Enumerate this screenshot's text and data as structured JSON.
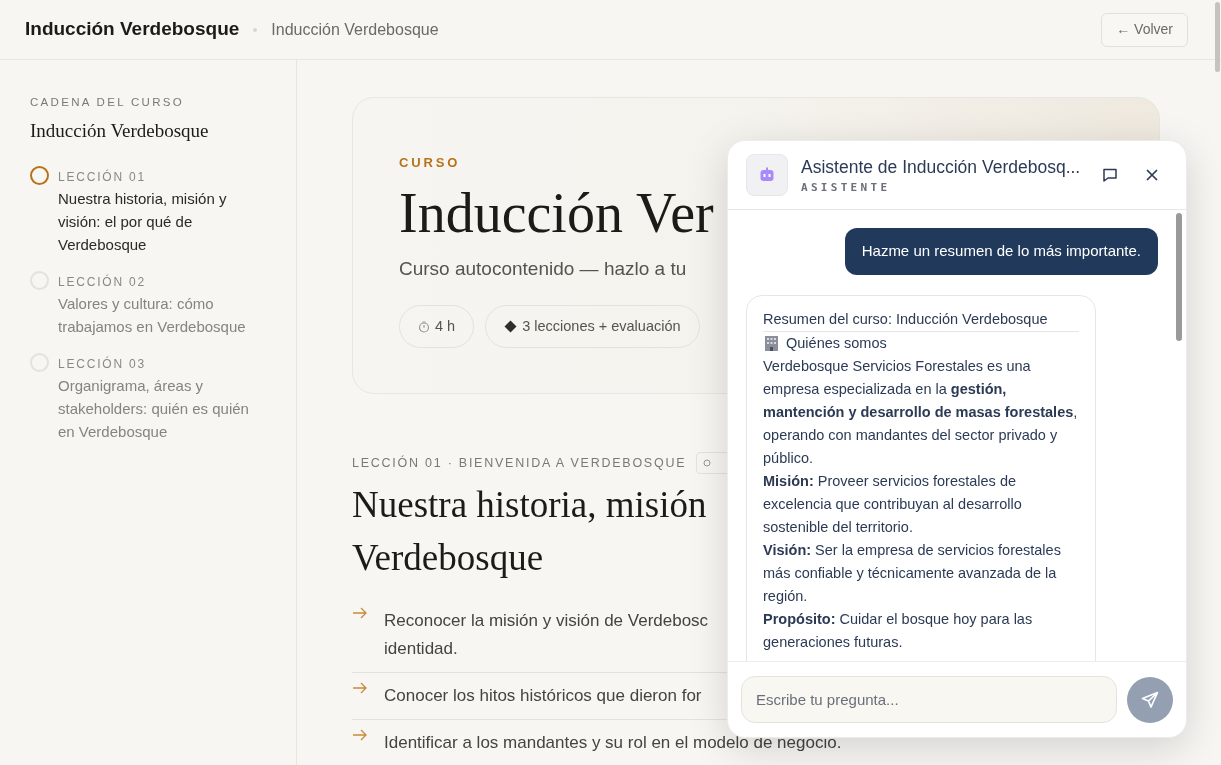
{
  "header": {
    "brand": "Inducción Verdebosque",
    "breadcrumb": "Inducción Verdebosque",
    "back_button": "← Volver"
  },
  "sidebar": {
    "eyebrow": "CADENA DEL CURSO",
    "title": "Inducción Verdebosque",
    "lessons": [
      {
        "label": "LECCIÓN 01",
        "title": "Nuestra historia, misión y visión: el por qué de Verdebosque",
        "selected": true
      },
      {
        "label": "LECCIÓN 02",
        "title": "Valores y cultura: cómo trabajamos en Verdebosque",
        "selected": false
      },
      {
        "label": "LECCIÓN 03",
        "title": "Organigrama, áreas y stakeholders: quién es quién en Verdebosque",
        "selected": false
      }
    ]
  },
  "hero": {
    "eyebrow": "CURSO",
    "title": "Inducción Ver",
    "subtitle": "Curso autocontenido — hazlo a tu",
    "chips": [
      {
        "kind": "clock",
        "text": "4 h"
      },
      {
        "kind": "diamond",
        "text": "3 lecciones + evaluación"
      }
    ]
  },
  "lesson": {
    "eyebrow": "LECCIÓN 01 · BIENVENIDA A VERDEBOSQUE",
    "heading_lines": [
      "Nuestra historia, misión",
      "Verdebosque"
    ],
    "objectives": [
      {
        "lines": [
          "Reconocer la misión y visión de Verdebosc",
          "identidad."
        ]
      },
      {
        "lines": [
          "Conocer los hitos históricos que dieron for"
        ]
      },
      {
        "lines": [
          "Identificar a los mandantes y su rol en el modelo de negocio."
        ]
      }
    ]
  },
  "chat": {
    "title": "Asistente de Inducción Verdebosq...",
    "subtitle": "ASISTENTE",
    "messages": [
      {
        "kind": "user",
        "text": "Hazme un resumen de lo más importante."
      },
      {
        "kind": "assistant",
        "blocks": [
          {
            "kind": "title",
            "text": "Resumen del curso: Inducción Verdebosque"
          },
          {
            "kind": "section",
            "text": "Quiénes somos"
          },
          {
            "kind": "para",
            "text": "Verdebosque Servicios Forestales es una empresa especializada en la **gestión, mantención y desarrollo de masas forestales**, operando con mandantes del sector privado y público."
          },
          {
            "kind": "para",
            "text": "**Misión:** Proveer servicios forestales de excelencia que contribuyan al desarrollo sostenible del territorio."
          },
          {
            "kind": "para",
            "text": "**Visión:** Ser la empresa de servicios forestales más confiable y técnicamente avanzada de la región."
          },
          {
            "kind": "para",
            "text": "**Propósito:** Cuidar el bosque hoy para las generaciones futuras."
          }
        ]
      }
    ],
    "input": {
      "placeholder": "Escribe tu pregunta..."
    }
  }
}
